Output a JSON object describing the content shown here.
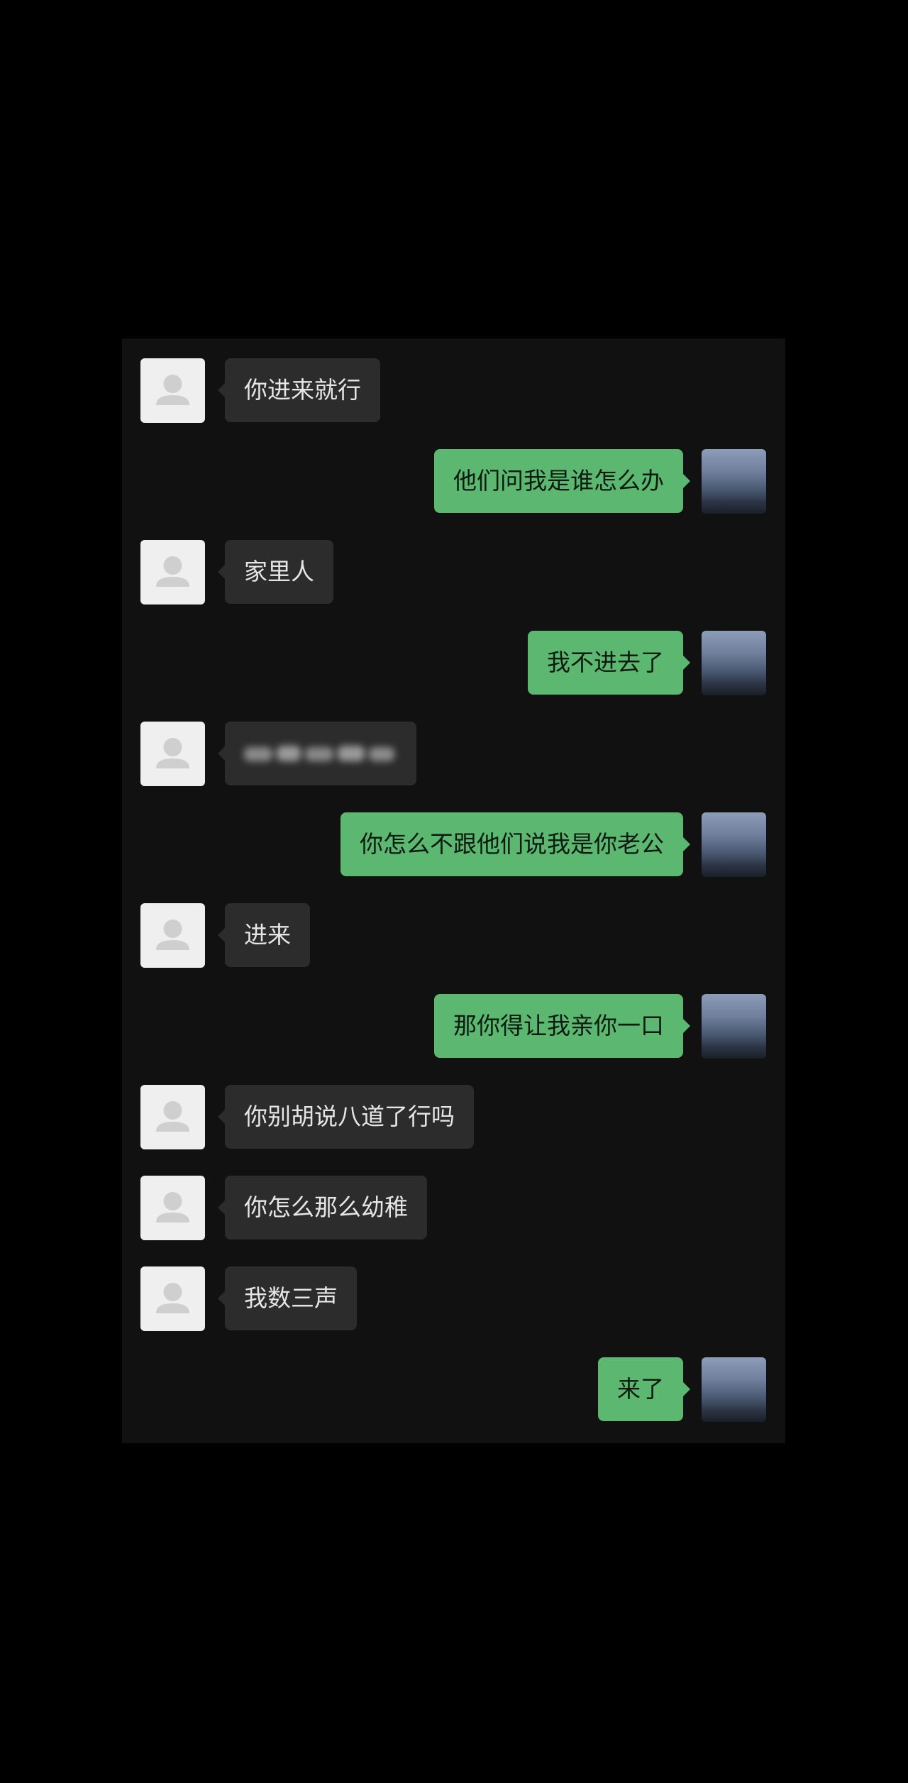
{
  "colors": {
    "background": "#000000",
    "chat_background": "#111111",
    "incoming_bubble": "#2c2c2c",
    "outgoing_bubble": "#5cb870"
  },
  "icons": {
    "incoming_avatar": "default-user-avatar-icon",
    "outgoing_avatar": "landscape-photo-avatar"
  },
  "messages": [
    {
      "side": "left",
      "text": "你进来就行"
    },
    {
      "side": "right",
      "text": "他们问我是谁怎么办"
    },
    {
      "side": "left",
      "text": "家里人"
    },
    {
      "side": "right",
      "text": "我不进去了"
    },
    {
      "side": "left",
      "text": "",
      "blurred": true
    },
    {
      "side": "right",
      "text": "你怎么不跟他们说我是你老公"
    },
    {
      "side": "left",
      "text": "进来"
    },
    {
      "side": "right",
      "text": "那你得让我亲你一口"
    },
    {
      "side": "left",
      "text": "你别胡说八道了行吗"
    },
    {
      "side": "left",
      "text": "你怎么那么幼稚"
    },
    {
      "side": "left",
      "text": "我数三声"
    },
    {
      "side": "right",
      "text": "来了"
    }
  ]
}
